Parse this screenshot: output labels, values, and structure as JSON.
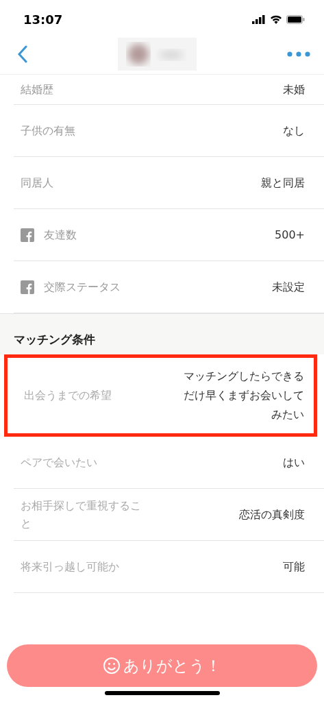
{
  "status_bar": {
    "time": "13:07"
  },
  "profile_rows": [
    {
      "kind": "plain",
      "label": "結婚歴",
      "value": "未婚"
    },
    {
      "kind": "plain",
      "label": "子供の有無",
      "value": "なし"
    },
    {
      "kind": "plain",
      "label": "同居人",
      "value": "親と同居"
    },
    {
      "kind": "facebook",
      "label": "友達数",
      "value": "500+"
    },
    {
      "kind": "facebook",
      "label": "交際ステータス",
      "value": "未設定"
    }
  ],
  "matching": {
    "title": "マッチング条件",
    "rows": [
      {
        "label": "出会うまでの希望",
        "value": "マッチングしたらできるだけ早くまずお会いしてみたい",
        "highlighted": true
      },
      {
        "label": "ペアで会いたい",
        "value": "はい",
        "highlighted": false
      },
      {
        "label": "お相手探しで重視すること",
        "value": "恋活の真剣度",
        "highlighted": false
      },
      {
        "label": "将来引っ越し可能か",
        "value": "可能",
        "highlighted": false
      }
    ]
  },
  "thanks_button": {
    "label": "ありがとう！"
  }
}
